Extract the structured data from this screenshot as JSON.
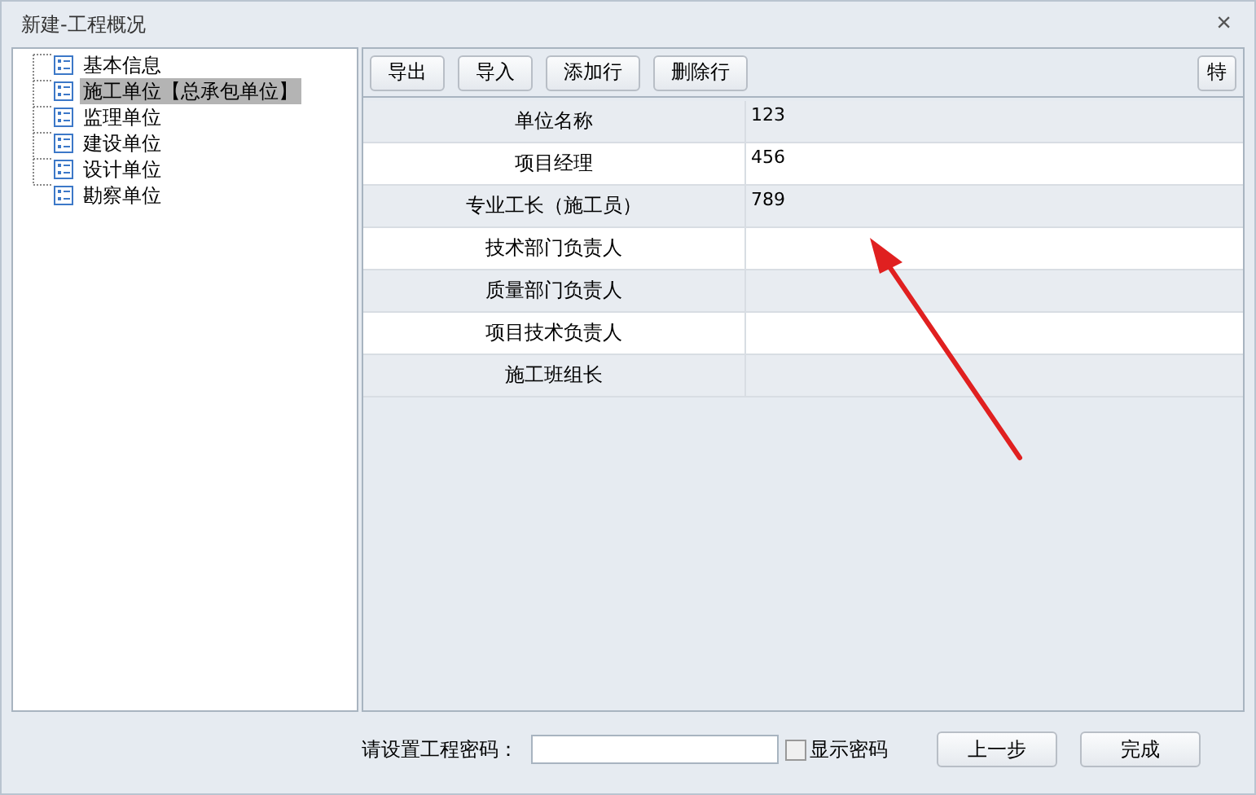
{
  "window": {
    "title": "新建-工程概况",
    "close": "×"
  },
  "tree": {
    "items": [
      {
        "label": "基本信息",
        "selected": false
      },
      {
        "label": "施工单位【总承包单位】",
        "selected": true
      },
      {
        "label": "监理单位",
        "selected": false
      },
      {
        "label": "建设单位",
        "selected": false
      },
      {
        "label": "设计单位",
        "selected": false
      },
      {
        "label": "勘察单位",
        "selected": false
      }
    ]
  },
  "toolbar": {
    "buttons": [
      "导出",
      "导入",
      "添加行",
      "删除行"
    ],
    "right_button": "特"
  },
  "table": {
    "rows": [
      {
        "label": "单位名称",
        "value": "123"
      },
      {
        "label": "项目经理",
        "value": "456"
      },
      {
        "label": "专业工长（施工员）",
        "value": "789"
      },
      {
        "label": "技术部门负责人",
        "value": ""
      },
      {
        "label": "质量部门负责人",
        "value": ""
      },
      {
        "label": "项目技术负责人",
        "value": ""
      },
      {
        "label": "施工班组长",
        "value": ""
      }
    ]
  },
  "footer": {
    "password_label": "请设置工程密码：",
    "show_password": {
      "label": "显示密码",
      "checked": false
    },
    "buttons": [
      "上一步",
      "完成"
    ]
  }
}
